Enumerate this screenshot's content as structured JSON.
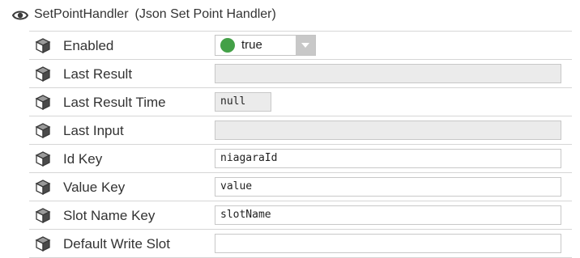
{
  "header": {
    "name": "SetPointHandler",
    "type": "(Json Set Point Handler)",
    "icon": "eye-icon"
  },
  "rows": [
    {
      "label": "Enabled",
      "kind": "dropdown",
      "value": "true",
      "status_color": "#43a047"
    },
    {
      "label": "Last Result",
      "kind": "readonly",
      "value": ""
    },
    {
      "label": "Last Result Time",
      "kind": "readonly-short",
      "value": "null"
    },
    {
      "label": "Last Input",
      "kind": "readonly",
      "value": ""
    },
    {
      "label": "Id Key",
      "kind": "text",
      "value": "niagaraId"
    },
    {
      "label": "Value Key",
      "kind": "text",
      "value": "value"
    },
    {
      "label": "Slot Name Key",
      "kind": "text",
      "value": "slotName"
    },
    {
      "label": "Default Write Slot",
      "kind": "text",
      "value": ""
    }
  ],
  "slot_icon": "slot-cube-icon"
}
